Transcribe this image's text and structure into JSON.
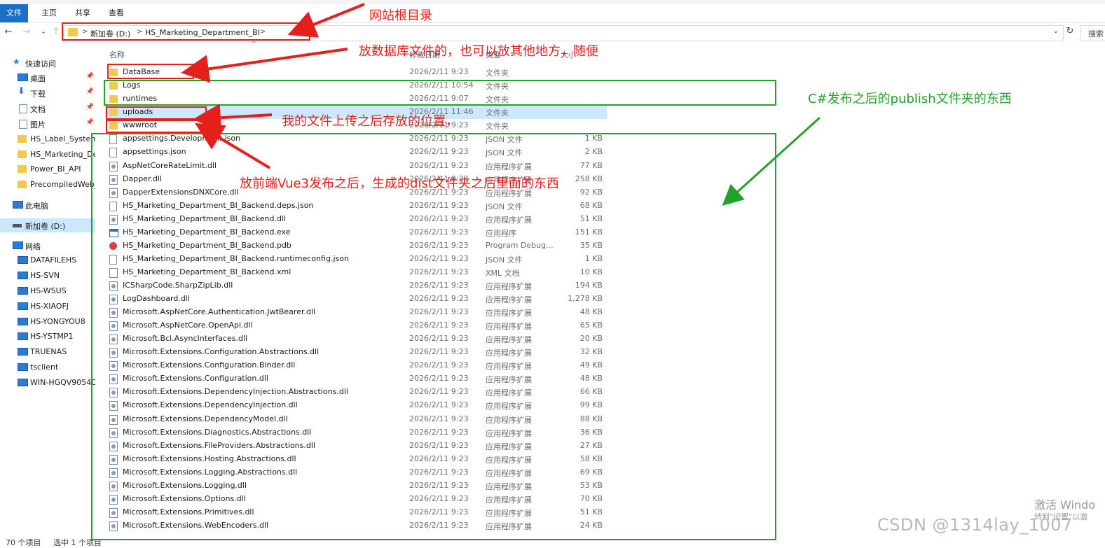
{
  "window": {
    "title": "HS_Marketing_Department_BI"
  },
  "ribbon": {
    "tabs": [
      "文件",
      "主页",
      "共享",
      "查看"
    ]
  },
  "nav_buttons": {
    "back": "←",
    "forward": "→",
    "recent": "⌄",
    "up": "↑"
  },
  "address": {
    "crumbs": [
      "新加卷 (D:)",
      "HS_Marketing_Department_BI"
    ],
    "sep": ">",
    "dropdown": "⌄",
    "refresh": "↻"
  },
  "search": {
    "placeholder": "搜索"
  },
  "sidebar": {
    "items": [
      {
        "label": "快速访问",
        "icon": "star-icon"
      },
      {
        "label": "桌面",
        "icon": "desktop-icon",
        "pinned": true
      },
      {
        "label": "下载",
        "icon": "download-icon",
        "pinned": true
      },
      {
        "label": "文档",
        "icon": "document-icon",
        "pinned": true
      },
      {
        "label": "图片",
        "icon": "pictures-icon",
        "pinned": true
      },
      {
        "label": "HS_Label_System",
        "icon": "folder-icon"
      },
      {
        "label": "HS_Marketing_De",
        "icon": "folder-icon"
      },
      {
        "label": "Power_BI_API",
        "icon": "folder-icon"
      },
      {
        "label": "PrecompiledWeb_",
        "icon": "folder-icon"
      },
      {
        "label": "此电脑",
        "icon": "computer-icon"
      },
      {
        "label": "新加卷 (D:)",
        "icon": "drive-icon"
      },
      {
        "label": "网络",
        "icon": "network-icon"
      },
      {
        "label": "DATAFILEHS",
        "icon": "network-computer-icon"
      },
      {
        "label": "HS-SVN",
        "icon": "network-computer-icon"
      },
      {
        "label": "HS-WSUS",
        "icon": "network-computer-icon"
      },
      {
        "label": "HS-XIAOFJ",
        "icon": "network-computer-icon"
      },
      {
        "label": "HS-YONGYOU8",
        "icon": "network-computer-icon"
      },
      {
        "label": "HS-YSTMP1",
        "icon": "network-computer-icon"
      },
      {
        "label": "TRUENAS",
        "icon": "network-computer-icon"
      },
      {
        "label": "tsclient",
        "icon": "network-computer-icon"
      },
      {
        "label": "WIN-HGQV9054D",
        "icon": "network-computer-icon"
      }
    ],
    "pin_glyph": "📌"
  },
  "list": {
    "headers": {
      "name": "名称",
      "date": "修改日期",
      "type": "类型",
      "size": "大小"
    },
    "sort_glyph": "^",
    "files": [
      {
        "name": "DataBase",
        "date": "2026/2/11 9:23",
        "type": "文件夹",
        "size": "",
        "icon": "folder"
      },
      {
        "name": "Logs",
        "date": "2026/2/11 10:54",
        "type": "文件夹",
        "size": "",
        "icon": "folder"
      },
      {
        "name": "runtimes",
        "date": "2026/2/11 9:07",
        "type": "文件夹",
        "size": "",
        "icon": "folder"
      },
      {
        "name": "uploads",
        "date": "2026/2/11 11:46",
        "type": "文件夹",
        "size": "",
        "icon": "folder"
      },
      {
        "name": "wwwroot",
        "date": "2026/2/11 9:23",
        "type": "文件夹",
        "size": "",
        "icon": "folder"
      },
      {
        "name": "appsettings.Development.json",
        "date": "2026/2/11 9:23",
        "type": "JSON 文件",
        "size": "1 KB",
        "icon": "file"
      },
      {
        "name": "appsettings.json",
        "date": "2026/2/11 9:23",
        "type": "JSON 文件",
        "size": "2 KB",
        "icon": "file"
      },
      {
        "name": "AspNetCoreRateLimit.dll",
        "date": "2026/2/11 9:23",
        "type": "应用程序扩展",
        "size": "77 KB",
        "icon": "dll"
      },
      {
        "name": "Dapper.dll",
        "date": "2026/2/11 9:23",
        "type": "应用程序扩展",
        "size": "258 KB",
        "icon": "dll"
      },
      {
        "name": "DapperExtensionsDNXCore.dll",
        "date": "2026/2/11 9:23",
        "type": "应用程序扩展",
        "size": "92 KB",
        "icon": "dll"
      },
      {
        "name": "HS_Marketing_Department_BI_Backend.deps.json",
        "date": "2026/2/11 9:23",
        "type": "JSON 文件",
        "size": "68 KB",
        "icon": "file"
      },
      {
        "name": "HS_Marketing_Department_BI_Backend.dll",
        "date": "2026/2/11 9:23",
        "type": "应用程序扩展",
        "size": "51 KB",
        "icon": "dll"
      },
      {
        "name": "HS_Marketing_Department_BI_Backend.exe",
        "date": "2026/2/11 9:23",
        "type": "应用程序",
        "size": "151 KB",
        "icon": "exe"
      },
      {
        "name": "HS_Marketing_Department_BI_Backend.pdb",
        "date": "2026/2/11 9:23",
        "type": "Program Debug...",
        "size": "35 KB",
        "icon": "pdb"
      },
      {
        "name": "HS_Marketing_Department_BI_Backend.runtimeconfig.json",
        "date": "2026/2/11 9:23",
        "type": "JSON 文件",
        "size": "1 KB",
        "icon": "file"
      },
      {
        "name": "HS_Marketing_Department_BI_Backend.xml",
        "date": "2026/2/11 9:23",
        "type": "XML 文档",
        "size": "10 KB",
        "icon": "xml"
      },
      {
        "name": "ICSharpCode.SharpZipLib.dll",
        "date": "2026/2/11 9:23",
        "type": "应用程序扩展",
        "size": "194 KB",
        "icon": "dll"
      },
      {
        "name": "LogDashboard.dll",
        "date": "2026/2/11 9:23",
        "type": "应用程序扩展",
        "size": "1,278 KB",
        "icon": "dll"
      },
      {
        "name": "Microsoft.AspNetCore.Authentication.JwtBearer.dll",
        "date": "2026/2/11 9:23",
        "type": "应用程序扩展",
        "size": "48 KB",
        "icon": "dll"
      },
      {
        "name": "Microsoft.AspNetCore.OpenApi.dll",
        "date": "2026/2/11 9:23",
        "type": "应用程序扩展",
        "size": "65 KB",
        "icon": "dll"
      },
      {
        "name": "Microsoft.Bcl.AsyncInterfaces.dll",
        "date": "2026/2/11 9:23",
        "type": "应用程序扩展",
        "size": "20 KB",
        "icon": "dll"
      },
      {
        "name": "Microsoft.Extensions.Configuration.Abstractions.dll",
        "date": "2026/2/11 9:23",
        "type": "应用程序扩展",
        "size": "32 KB",
        "icon": "dll"
      },
      {
        "name": "Microsoft.Extensions.Configuration.Binder.dll",
        "date": "2026/2/11 9:23",
        "type": "应用程序扩展",
        "size": "49 KB",
        "icon": "dll"
      },
      {
        "name": "Microsoft.Extensions.Configuration.dll",
        "date": "2026/2/11 9:23",
        "type": "应用程序扩展",
        "size": "48 KB",
        "icon": "dll"
      },
      {
        "name": "Microsoft.Extensions.DependencyInjection.Abstractions.dll",
        "date": "2026/2/11 9:23",
        "type": "应用程序扩展",
        "size": "66 KB",
        "icon": "dll"
      },
      {
        "name": "Microsoft.Extensions.DependencyInjection.dll",
        "date": "2026/2/11 9:23",
        "type": "应用程序扩展",
        "size": "99 KB",
        "icon": "dll"
      },
      {
        "name": "Microsoft.Extensions.DependencyModel.dll",
        "date": "2026/2/11 9:23",
        "type": "应用程序扩展",
        "size": "88 KB",
        "icon": "dll"
      },
      {
        "name": "Microsoft.Extensions.Diagnostics.Abstractions.dll",
        "date": "2026/2/11 9:23",
        "type": "应用程序扩展",
        "size": "36 KB",
        "icon": "dll"
      },
      {
        "name": "Microsoft.Extensions.FileProviders.Abstractions.dll",
        "date": "2026/2/11 9:23",
        "type": "应用程序扩展",
        "size": "27 KB",
        "icon": "dll"
      },
      {
        "name": "Microsoft.Extensions.Hosting.Abstractions.dll",
        "date": "2026/2/11 9:23",
        "type": "应用程序扩展",
        "size": "58 KB",
        "icon": "dll"
      },
      {
        "name": "Microsoft.Extensions.Logging.Abstractions.dll",
        "date": "2026/2/11 9:23",
        "type": "应用程序扩展",
        "size": "69 KB",
        "icon": "dll"
      },
      {
        "name": "Microsoft.Extensions.Logging.dll",
        "date": "2026/2/11 9:23",
        "type": "应用程序扩展",
        "size": "53 KB",
        "icon": "dll"
      },
      {
        "name": "Microsoft.Extensions.Options.dll",
        "date": "2026/2/11 9:23",
        "type": "应用程序扩展",
        "size": "70 KB",
        "icon": "dll"
      },
      {
        "name": "Microsoft.Extensions.Primitives.dll",
        "date": "2026/2/11 9:23",
        "type": "应用程序扩展",
        "size": "51 KB",
        "icon": "dll"
      },
      {
        "name": "Microsoft.Extensions.WebEncoders.dll",
        "date": "2026/2/11 9:23",
        "type": "应用程序扩展",
        "size": "24 KB",
        "icon": "dll"
      }
    ]
  },
  "status": {
    "items": "70 个项目",
    "selected": "选中 1 个项目"
  },
  "annotations": {
    "site_root": "网站根目录",
    "database": "放数据库文件的，也可以放其他地方，随便",
    "uploads": "我的文件上传之后存放的位置，",
    "frontend": "放前端Vue3发布之后，生成的dist文件夹之后里面的东西",
    "publish": "C#发布之后的publish文件夹的东西"
  },
  "colors": {
    "annotation_red": "#e5201c",
    "annotation_green": "#21a32b",
    "selection": "#cce8ff",
    "accent": "#1a6fc4"
  },
  "watermark": {
    "activate": "激活 Windo",
    "activate_sub": "转到\"设置\"以激",
    "csdn": "CSDN @1314lay_1007"
  }
}
